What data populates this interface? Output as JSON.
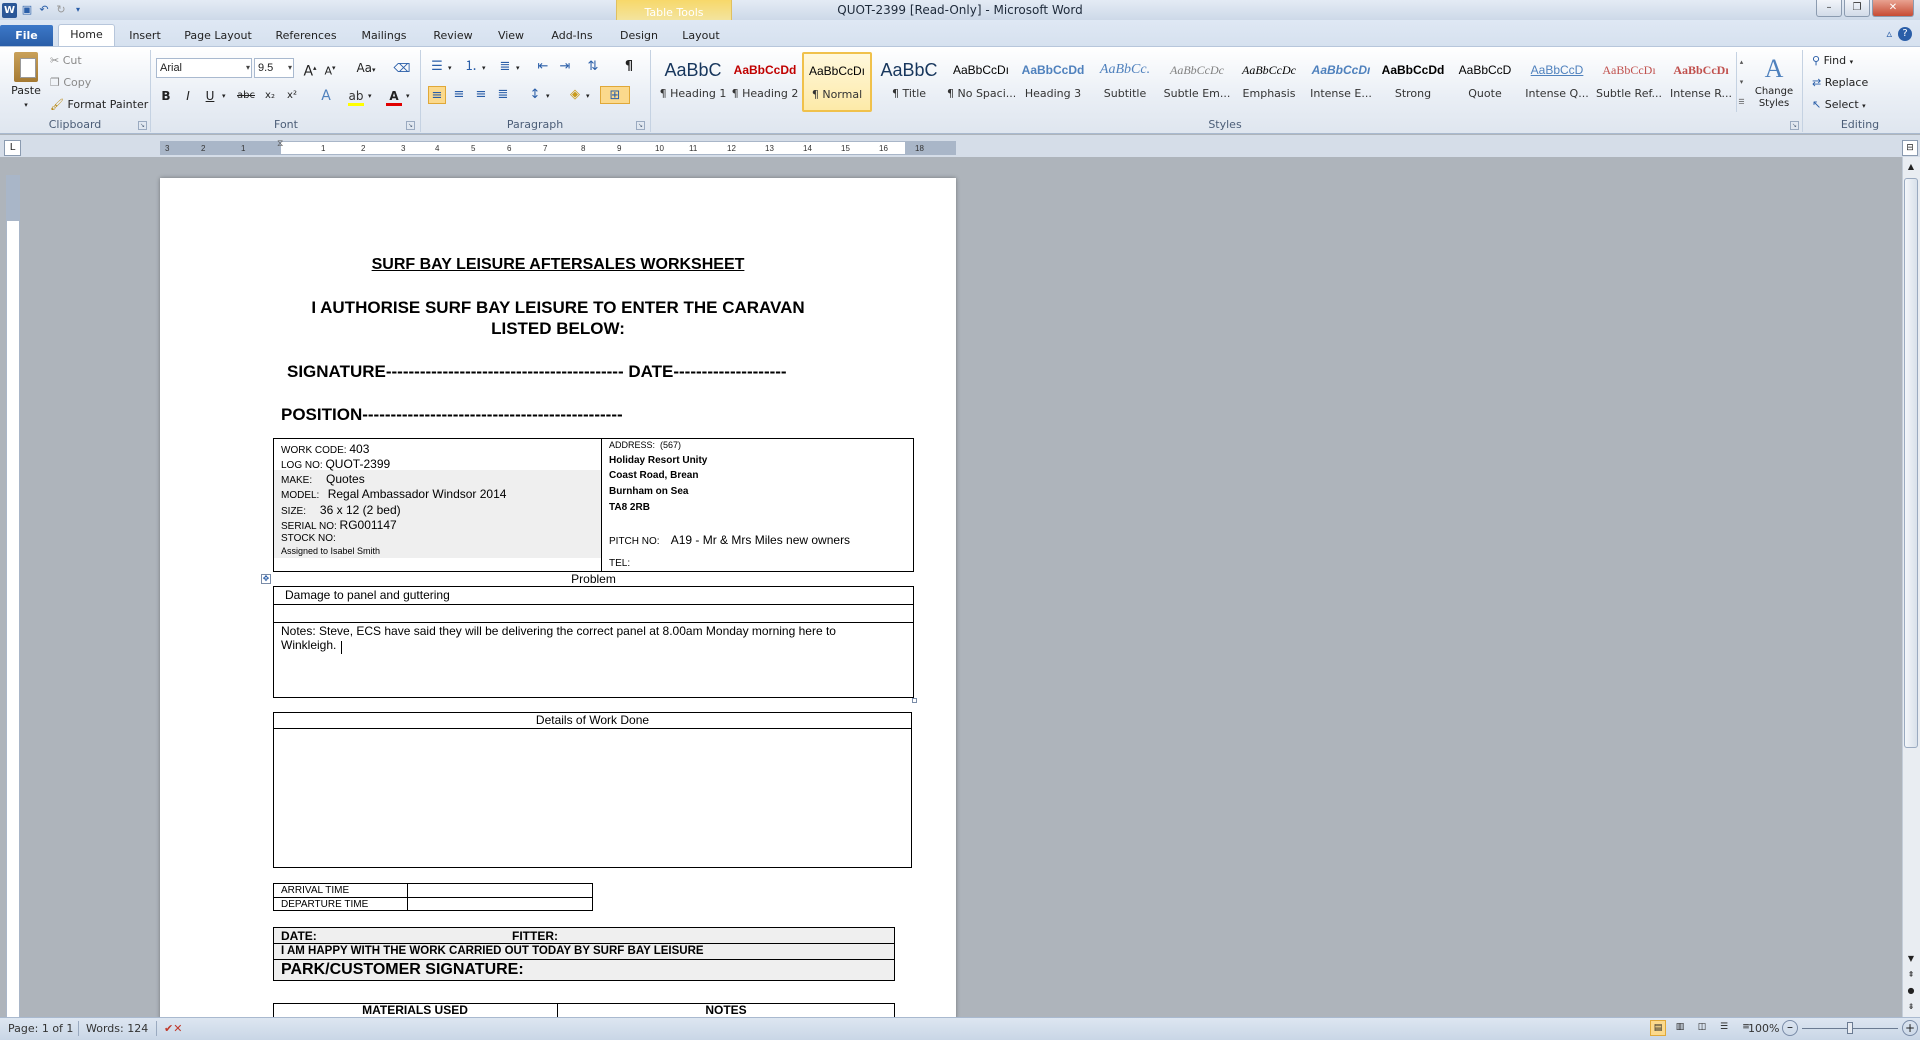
{
  "window": {
    "title": "QUOT-2399 [Read-Only] - Microsoft Word",
    "contextual_tab_group": "Table Tools",
    "controls": [
      "minimize",
      "restore",
      "close"
    ]
  },
  "tabs": {
    "file": "File",
    "home": "Home",
    "insert": "Insert",
    "page_layout": "Page Layout",
    "references": "References",
    "mailings": "Mailings",
    "review": "Review",
    "view": "View",
    "add_ins": "Add-Ins",
    "design": "Design",
    "layout": "Layout"
  },
  "ribbon": {
    "clipboard": {
      "label": "Clipboard",
      "paste": "Paste",
      "cut": "Cut",
      "copy": "Copy",
      "format_painter": "Format Painter"
    },
    "font": {
      "label": "Font",
      "font_name": "Arial",
      "font_size": "9.5",
      "bold": "B",
      "italic": "I",
      "underline": "U",
      "strikethrough": "abc",
      "subscript": "x₂",
      "superscript": "x²",
      "change_case": "Aa",
      "grow": "A",
      "shrink": "A"
    },
    "paragraph": {
      "label": "Paragraph",
      "show_marks": "¶"
    },
    "styles": {
      "label": "Styles",
      "items": [
        {
          "preview": "AaBbC",
          "name": "¶ Heading 1",
          "color": "#17365d"
        },
        {
          "preview": "AaBbCcDd",
          "name": "¶ Heading 2",
          "color": "#c00000"
        },
        {
          "preview": "AaBbCcDı",
          "name": "¶ Normal",
          "color": "#000000"
        },
        {
          "preview": "AaBbC",
          "name": "¶ Title",
          "color": "#17365d"
        },
        {
          "preview": "AaBbCcDı",
          "name": "¶ No Spaci...",
          "color": "#000000"
        },
        {
          "preview": "AaBbCcDd",
          "name": "Heading 3",
          "color": "#4f81bd"
        },
        {
          "preview": "AaBbCc.",
          "name": "Subtitle",
          "color": "#4f81bd"
        },
        {
          "preview": "AaBbCcDc",
          "name": "Subtle Em...",
          "color": "#808080"
        },
        {
          "preview": "AaBbCcDc",
          "name": "Emphasis",
          "color": "#000000"
        },
        {
          "preview": "AaBbCcDı",
          "name": "Intense E...",
          "color": "#4f81bd"
        },
        {
          "preview": "AaBbCcDd",
          "name": "Strong",
          "color": "#000000"
        },
        {
          "preview": "AaBbCcD",
          "name": "Quote",
          "color": "#000000"
        },
        {
          "preview": "AaBbCcD",
          "name": "Intense Q...",
          "color": "#4f81bd"
        },
        {
          "preview": "AaBbCcDı",
          "name": "Subtle Ref...",
          "color": "#c0504d"
        },
        {
          "preview": "AaBbCcDı",
          "name": "Intense R...",
          "color": "#c0504d"
        }
      ],
      "change_styles": "Change Styles"
    },
    "editing": {
      "label": "Editing",
      "find": "Find",
      "replace": "Replace",
      "select": "Select"
    }
  },
  "ruler": {
    "ticks": [
      "3",
      "2",
      "1",
      "1",
      "2",
      "3",
      "4",
      "5",
      "6",
      "7",
      "8",
      "9",
      "10",
      "11",
      "12",
      "13",
      "14",
      "15",
      "16",
      "18"
    ]
  },
  "document": {
    "heading": "SURF BAY LEISURE AFTERSALES WORKSHEET",
    "authorise_line1": "I AUTHORISE SURF BAY LEISURE TO ENTER THE CARAVAN",
    "authorise_line2": "LISTED BELOW:",
    "signature_line": "SIGNATURE------------------------------------------ DATE--------------------",
    "position_line": "POSITION----------------------------------------------",
    "info": {
      "work_code_label": "WORK CODE:",
      "work_code": "403",
      "log_no_label": "LOG NO:",
      "log_no": "QUOT-2399",
      "make_label": "MAKE:",
      "make": "Quotes",
      "model_label": "MODEL:",
      "model": "Regal Ambassador Windsor 2014",
      "size_label": "SIZE:",
      "size": "36 x 12 (2 bed)",
      "serial_label": "SERIAL NO:",
      "serial": "RG001147",
      "stock_label": "STOCK NO:",
      "assigned": "Assigned to Isabel Smith",
      "address_label": "ADDRESS:",
      "address_code": "(567)",
      "address_lines": [
        "Holiday Resort Unity",
        "Coast Road, Brean",
        "Burnham on Sea",
        "TA8 2RB"
      ],
      "pitch_label": "PITCH NO:",
      "pitch": "A19 - Mr & Mrs Miles new owners",
      "tel_label": "TEL:"
    },
    "problem_header": "Problem",
    "problem_text": "Damage to panel and guttering",
    "notes": "Notes: Steve, ECS have said they will be delivering the correct panel at 8.00am Monday morning here to Winkleigh.",
    "details_header": "Details of Work Done",
    "arrival_label": "ARRIVAL  TIME",
    "departure_label": "DEPARTURE  TIME",
    "date_label": "DATE:",
    "fitter_label": "FITTER:",
    "happy_line": "I AM HAPPY WITH THE WORK CARRIED OUT TODAY BY SURF BAY LEISURE",
    "customer_signature": "PARK/CUSTOMER SIGNATURE:",
    "materials_header": "MATERIALS USED",
    "notes_header": "NOTES"
  },
  "status": {
    "page": "Page: 1 of 1",
    "words": "Words: 124",
    "zoom": "100%",
    "zoom_level": 100
  }
}
